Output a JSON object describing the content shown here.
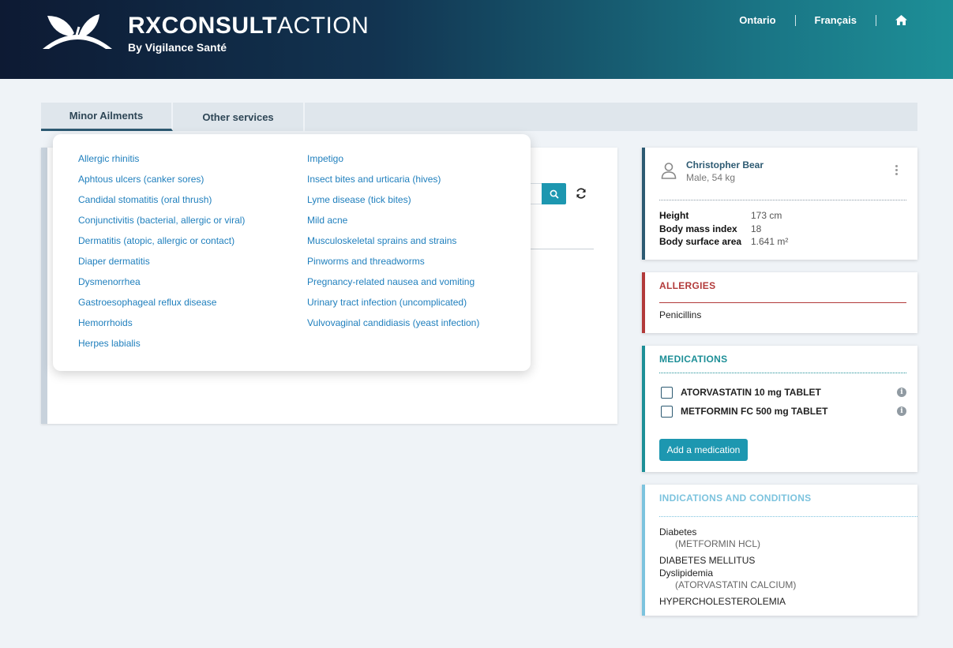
{
  "header": {
    "brand_bold": "RXCONSULT",
    "brand_light": "ACTION",
    "brand_sub": "By Vigilance Santé",
    "nav": [
      "Ontario",
      "Français"
    ],
    "home_icon": "home-icon"
  },
  "tabs": [
    {
      "label": "Minor Ailments",
      "active": true
    },
    {
      "label": "Other services",
      "active": false
    }
  ],
  "dropdown": {
    "col1": [
      "Allergic rhinitis",
      "Aphtous ulcers (canker sores)",
      "Candidal stomatitis (oral thrush)",
      "Conjunctivitis (bacterial, allergic or viral)",
      "Dermatitis (atopic, allergic or contact)",
      "Diaper dermatitis",
      "Dysmenorrhea",
      "Gastroesophageal reflux disease",
      "Hemorrhoids",
      "Herpes labialis"
    ],
    "col2": [
      "Impetigo",
      "Insect bites and urticaria (hives)",
      "Lyme disease (tick bites)",
      "Mild acne",
      "Musculoskeletal sprains and strains",
      "Pinworms and threadworms",
      "Pregnancy-related nausea and vomiting",
      "Urinary tract infection (uncomplicated)",
      "Vulvovaginal candidiasis (yeast infection)"
    ]
  },
  "patient": {
    "name": "Christopher Bear",
    "sub": "Male, 54 kg",
    "metrics": [
      {
        "label": "Height",
        "value": "173 cm"
      },
      {
        "label": "Body mass index",
        "value": "18"
      },
      {
        "label": "Body surface area",
        "value": "1.641 m²"
      }
    ]
  },
  "allergies": {
    "title": "ALLERGIES",
    "items": [
      "Penicillins"
    ],
    "color": "#b23a3a"
  },
  "medications": {
    "title": "MEDICATIONS",
    "items": [
      "ATORVASTATIN 10 mg TABLET",
      "METFORMIN FC 500 mg TABLET"
    ],
    "add_label": "Add a medication",
    "color": "#1d8f97"
  },
  "indications": {
    "title": "INDICATIONS AND CONDITIONS",
    "lines": {
      "c1": "Diabetes",
      "d1": "(METFORMIN HCL)",
      "u1": "DIABETES MELLITUS",
      "c2": "Dyslipidemia",
      "d2": "(ATORVASTATIN CALCIUM)",
      "u2": "HYPERCHOLESTEROLEMIA"
    },
    "color": "#7cc3de"
  }
}
